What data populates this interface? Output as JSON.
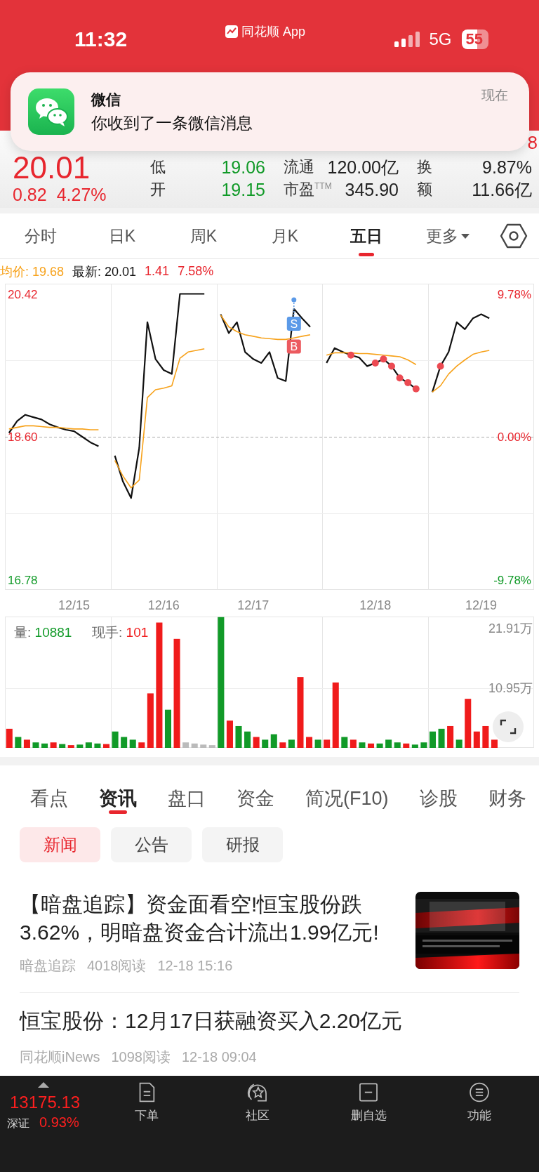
{
  "status_bar": {
    "time": "11:32",
    "app_label": "同花顺 App",
    "network": "5G",
    "battery": "55"
  },
  "notification": {
    "app": "微信",
    "message": "你收到了一条微信消息",
    "time": "现在"
  },
  "quote": {
    "price": "20.01",
    "change": "0.82",
    "change_pct": "4.27%",
    "partial_value": "8",
    "stats": [
      [
        {
          "label": "低",
          "value": "19.06",
          "color": "#119a28"
        },
        {
          "label": "流通",
          "value": "120.00亿",
          "color": "#222222"
        },
        {
          "label": "换",
          "value": "9.87%",
          "color": "#222222"
        }
      ],
      [
        {
          "label": "开",
          "value": "19.15",
          "color": "#119a28"
        },
        {
          "label": "市盈$^{TTM}$",
          "value": "345.90",
          "color": "#222222"
        },
        {
          "label": "额",
          "value": "11.66亿",
          "color": "#222222"
        }
      ]
    ]
  },
  "period_tabs": [
    {
      "label": "分时",
      "selected": false,
      "kind": "tab"
    },
    {
      "label": "日K",
      "selected": false,
      "kind": "tab"
    },
    {
      "label": "周K",
      "selected": false,
      "kind": "tab"
    },
    {
      "label": "月K",
      "selected": false,
      "kind": "tab"
    },
    {
      "label": "五日",
      "selected": true,
      "kind": "tab"
    },
    {
      "label": "更多",
      "selected": false,
      "kind": "menu"
    }
  ],
  "info_line": {
    "avg": "均价: 19.68",
    "latest": "最新: 20.01",
    "change": "1.41",
    "change_pct": "7.58%"
  },
  "price_chart": {
    "right_labels": [
      "9.78%",
      "0.00%",
      "-9.78%"
    ],
    "trades": [
      {
        "label": "S",
        "color": "#5b9ae8"
      },
      {
        "label": "B",
        "color": "#ec5a5f"
      }
    ],
    "chart_data": {
      "type": "line",
      "categories": [
        null,
        null,
        null,
        null,
        null,
        null,
        null,
        null,
        "12/15",
        null,
        null,
        null,
        null,
        null,
        null,
        null,
        null,
        null,
        null,
        "12/16",
        null,
        null,
        null,
        null,
        null,
        null,
        null,
        null,
        null,
        null,
        "12/17",
        null,
        null,
        null,
        null,
        null,
        null,
        null,
        null,
        null,
        null,
        null,
        null,
        null,
        null,
        "12/18",
        null,
        null,
        null,
        null,
        null,
        null,
        null,
        null,
        null,
        null,
        null,
        null,
        "12/19",
        null,
        null,
        null,
        null,
        null,
        null
      ],
      "ylim": [
        16.32,
        20.55
      ],
      "yticks": [
        {
          "value": 20.42,
          "label": "20.42"
        },
        {
          "value": 18.6,
          "label": "18.60"
        },
        {
          "value": 16.78,
          "label": "16.78"
        }
      ],
      "series": [
        {
          "color": "#111111",
          "values": [
            18.65,
            18.8,
            18.88,
            18.85,
            18.82,
            18.76,
            18.72,
            18.69,
            18.67,
            18.6,
            18.53,
            18.48,
            null,
            18.36,
            18.03,
            17.82,
            18.46,
            20.06,
            19.59,
            19.45,
            19.4,
            20.42,
            20.42,
            20.42,
            20.42,
            null,
            20.16,
            19.92,
            20.06,
            19.68,
            19.59,
            19.54,
            19.68,
            19.35,
            19.31,
            20.23,
            20.11,
            20.0,
            null,
            19.54,
            19.73,
            19.68,
            19.64,
            19.61,
            19.5,
            19.54,
            19.59,
            19.5,
            19.35,
            19.29,
            19.21,
            null,
            19.17,
            19.5,
            19.68,
            20.06,
            19.97,
            20.11,
            20.16,
            20.11,
            null,
            null,
            null,
            null,
            null
          ]
        },
        {
          "color": "#f7a21b",
          "values": [
            18.7,
            18.72,
            18.74,
            18.74,
            18.73,
            18.72,
            18.72,
            18.71,
            18.7,
            18.7,
            18.69,
            18.69,
            null,
            18.3,
            18.1,
            17.95,
            18.05,
            19.1,
            19.2,
            19.22,
            19.25,
            19.6,
            19.68,
            19.7,
            19.72,
            null,
            20.15,
            20.0,
            19.94,
            19.9,
            19.88,
            19.86,
            19.85,
            19.84,
            19.84,
            19.86,
            19.88,
            19.9,
            null,
            19.64,
            19.67,
            19.67,
            19.67,
            19.66,
            19.66,
            19.65,
            19.64,
            19.63,
            19.62,
            19.58,
            19.52,
            null,
            19.17,
            19.25,
            19.4,
            19.5,
            19.58,
            19.65,
            19.68,
            19.7,
            null,
            null,
            null,
            null,
            null
          ]
        }
      ]
    }
  },
  "volume_chart": {
    "volume_label": "量:",
    "volume": "10881",
    "tick_label": "现手:",
    "tick": "101",
    "chart_data": {
      "type": "bar",
      "stacked": true,
      "categories": [
        null,
        null,
        null,
        null,
        null,
        null,
        null,
        null,
        null,
        null,
        null,
        null,
        null,
        null,
        null,
        null,
        null,
        null,
        null,
        null,
        null,
        null,
        null,
        null,
        null,
        null,
        null,
        null,
        null,
        null,
        null,
        null,
        null,
        null,
        null,
        null,
        null,
        null,
        null,
        null,
        null,
        null,
        null,
        null,
        null,
        null,
        null,
        null,
        null,
        null,
        null,
        null,
        null,
        null,
        null,
        null
      ],
      "ylim": [
        0,
        24.1
      ],
      "yticks": [
        {
          "value": 21.91,
          "label": "21.91万"
        },
        {
          "value": 10.95,
          "label": "10.95万"
        }
      ],
      "series": [
        {
          "color": "#f01b1b",
          "values": [
            3.5,
            null,
            1.5,
            null,
            null,
            1,
            null,
            0.5,
            null,
            null,
            null,
            0.7,
            null,
            null,
            null,
            1,
            10,
            23,
            null,
            20,
            null,
            null,
            null,
            null,
            null,
            5,
            null,
            null,
            2,
            null,
            null,
            1,
            null,
            13,
            2,
            null,
            1.5,
            12,
            null,
            1.5,
            null,
            0.8,
            null,
            null,
            null,
            0.8,
            null,
            null,
            null,
            null,
            4,
            null,
            9,
            3,
            4,
            1.5
          ]
        },
        {
          "color": "#119a28",
          "values": [
            null,
            2,
            null,
            1,
            0.8,
            null,
            0.7,
            null,
            0.6,
            1,
            0.8,
            null,
            3,
            2,
            1.5,
            null,
            null,
            null,
            7,
            null,
            null,
            null,
            null,
            null,
            24,
            null,
            4,
            3,
            null,
            1.5,
            2.5,
            null,
            1.5,
            null,
            null,
            1.5,
            null,
            null,
            2,
            null,
            1,
            null,
            0.8,
            1.5,
            1,
            null,
            0.6,
            1,
            3,
            3.5,
            null,
            1.5,
            null,
            null,
            null,
            null
          ]
        },
        {
          "color": "#bbbbbb",
          "values": [
            null,
            null,
            null,
            null,
            null,
            null,
            null,
            null,
            null,
            null,
            null,
            null,
            null,
            null,
            null,
            null,
            null,
            null,
            null,
            null,
            1,
            0.8,
            0.6,
            0.5,
            null,
            null,
            null,
            null,
            null,
            null,
            null,
            null,
            null,
            null,
            null,
            null,
            null,
            null,
            null,
            null,
            null,
            null,
            null,
            null,
            null,
            null,
            null,
            null,
            null,
            null,
            null,
            null,
            null,
            null,
            null,
            null
          ]
        }
      ]
    }
  },
  "info_tabs": [
    {
      "label": "看点",
      "selected": false
    },
    {
      "label": "资讯",
      "selected": true
    },
    {
      "label": "盘口",
      "selected": false
    },
    {
      "label": "资金",
      "selected": false
    },
    {
      "label": "简况(F10)",
      "selected": false
    },
    {
      "label": "诊股",
      "selected": false
    },
    {
      "label": "财务",
      "selected": false
    }
  ],
  "news_filters": [
    {
      "label": "新闻",
      "selected": true
    },
    {
      "label": "公告",
      "selected": false
    },
    {
      "label": "研报",
      "selected": false
    }
  ],
  "news": [
    {
      "title": "【暗盘追踪】资金面看空!恒宝股份跌3.62%，明暗盘资金合计流出1.99亿元!",
      "source": "暗盘追踪",
      "reads": "4018阅读",
      "time": "12-18 15:16"
    },
    {
      "title": "恒宝股份：12月17日获融资买入2.20亿元",
      "source": "同花顺iNews",
      "reads": "1098阅读",
      "time": "12-18 09:04"
    }
  ],
  "bottom_bar": {
    "index_value": "13175.13",
    "index_name": "深证",
    "index_change": "0.93%",
    "items": [
      {
        "label": "下单",
        "kind": "order"
      },
      {
        "label": "社区",
        "kind": "community"
      },
      {
        "label": "删自选",
        "kind": "remove"
      },
      {
        "label": "功能",
        "kind": "menu"
      }
    ]
  }
}
